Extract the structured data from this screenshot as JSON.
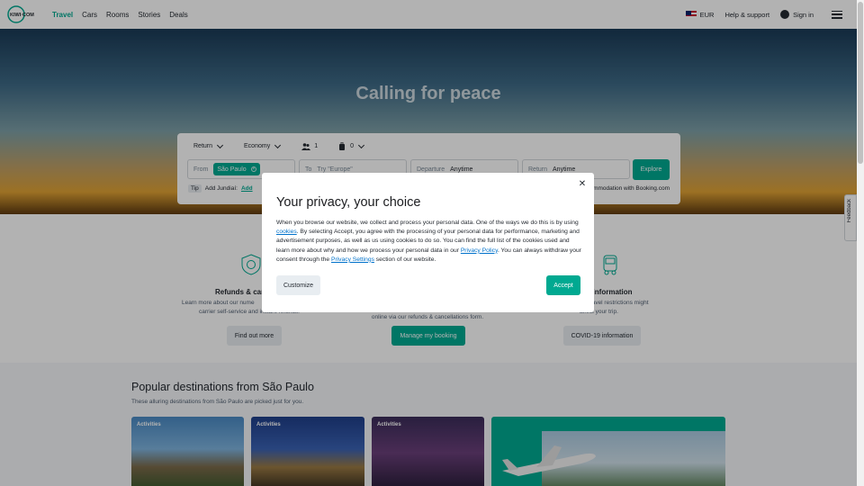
{
  "header": {
    "logo_text": "KIWI·COM",
    "nav": [
      {
        "label": "Travel",
        "active": true
      },
      {
        "label": "Cars",
        "active": false
      },
      {
        "label": "Rooms",
        "active": false
      },
      {
        "label": "Stories",
        "active": false
      },
      {
        "label": "Deals",
        "active": false
      }
    ],
    "currency": "EUR",
    "help": "Help & support",
    "sign_in": "Sign in"
  },
  "hero": {
    "title": "Calling for peace"
  },
  "search": {
    "trip_type": "Return",
    "cabin": "Economy",
    "passengers": "1",
    "bags": "0",
    "from_label": "From",
    "from_value": "São Paulo",
    "to_label": "To",
    "to_placeholder": "Try \"Europe\"",
    "departure_label": "Departure",
    "departure_value": "Anytime",
    "return_label": "Return",
    "return_value": "Anytime",
    "explore": "Explore",
    "tip_badge": "Tip",
    "tip_text": "Add Jundiaí:",
    "tip_add": "Add",
    "booking_label": "Check accommodation with Booking.com",
    "booking_checked": true
  },
  "features": {
    "refunds_title": "Refunds & can",
    "refunds_desc_1": "Learn more about our nume",
    "refunds_desc_2": "carrier self-service and instant refunds.",
    "refunds_button": "Find out more",
    "booking_desc": "online via our refunds & cancellations form.",
    "booking_button": "Manage my booking",
    "covid_title": "us information",
    "covid_desc_1": "new travel restrictions might",
    "covid_desc_2": "affect your trip.",
    "covid_button": "COVID-19 information"
  },
  "destinations": {
    "title": "Popular destinations from São Paulo",
    "subtitle": "These alluring destinations from São Paulo are picked just for you.",
    "cards": [
      {
        "tag": "Activities"
      },
      {
        "tag": "Activities"
      },
      {
        "tag": "Activities"
      }
    ]
  },
  "feedback": "Feedback",
  "modal": {
    "title": "Your privacy, your choice",
    "p1": "When you browse our website, we collect and process your personal data. One of the ways we do this is by using ",
    "cookies_link": "cookies",
    "p2": ". By selecting Accept, you agree with the processing of your personal data for performance, marketing and advertisement purposes, as well as us using cookies to do so. You can find the full list of the cookies used and learn more about why and how we process your personal data in our ",
    "privacy_policy_link": "Privacy Policy",
    "p3": ". You can always withdraw your consent through the ",
    "privacy_settings_link": "Privacy Settings",
    "p4": " section of our website.",
    "customize": "Customize",
    "accept": "Accept"
  },
  "colors": {
    "brand": "#00a991",
    "link": "#0172cb",
    "text": "#252a31"
  }
}
